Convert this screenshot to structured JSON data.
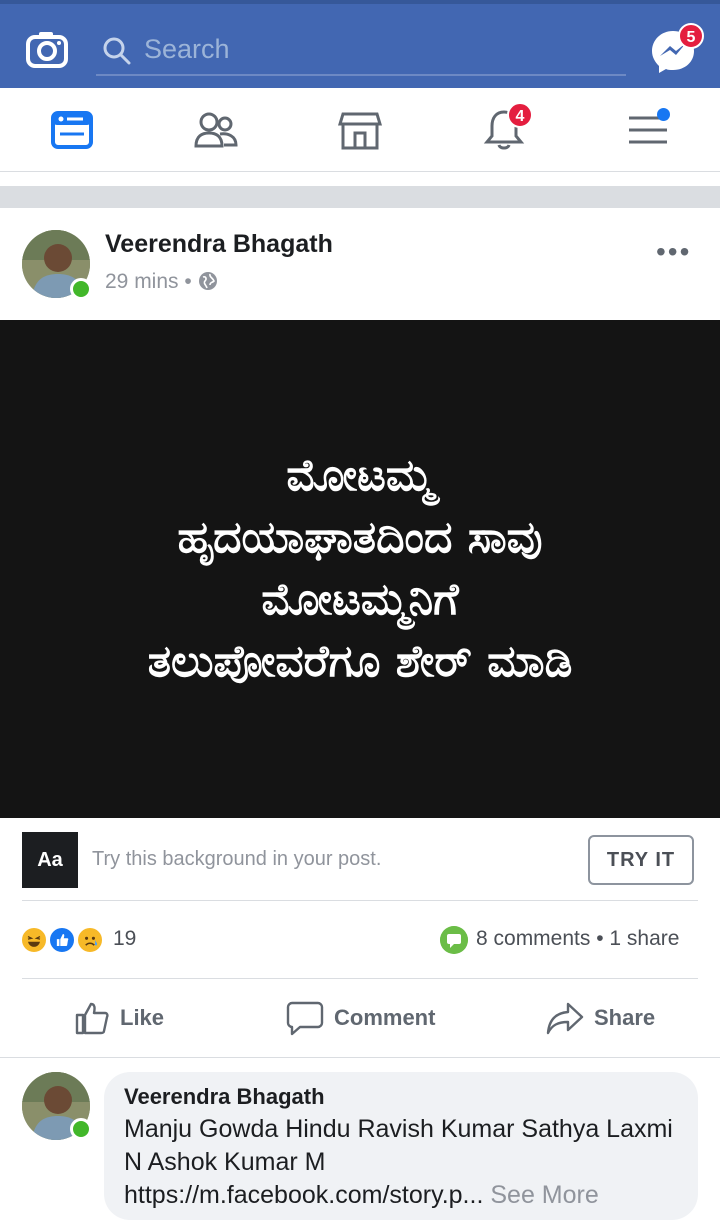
{
  "header": {
    "search_placeholder": "Search",
    "messenger_badge": "5",
    "notifications_badge": "4"
  },
  "post": {
    "author": "Veerendra Bhagath",
    "time": "29 mins",
    "meta_separator": "•",
    "body_lines": [
      "ಮೋಟಮ್ಮ",
      "ಹೃದಯಾಘಾತದಿಂದ ಸಾವು",
      "ಮೋಟಮ್ಮನಿಗೆ",
      "ತಲುಪೋವರೆಗೂ ಶೇರ್ ಮಾಡಿ"
    ],
    "background_color": "#141414"
  },
  "try_background": {
    "aa_label": "Aa",
    "text": "Try this background in your post.",
    "button": "TRY IT"
  },
  "stats": {
    "reaction_count": "19",
    "comments": "8 comments",
    "shares": "• 1 share"
  },
  "actions": {
    "like": "Like",
    "comment": "Comment",
    "share": "Share"
  },
  "comment": {
    "author": "Veerendra Bhagath",
    "text": "Manju Gowda Hindu Ravish Kumar Sathya Laxmi N Ashok Kumar M https://m.facebook.com/story.p...",
    "see_more": "See More"
  },
  "colors": {
    "brand_blue": "#4267b2",
    "badge_red": "#e41e3f",
    "online_green": "#42b72a"
  }
}
